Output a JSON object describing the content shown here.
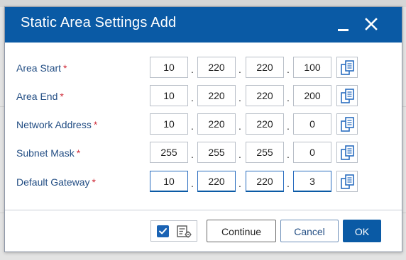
{
  "dialog": {
    "title": "Static Area Settings Add"
  },
  "title_bar": {
    "minimize_icon": "minimize-icon",
    "close_icon": "close-icon"
  },
  "required_marker": "*",
  "ip_separator": ".",
  "rows": [
    {
      "label": "Area Start",
      "octets": [
        "10",
        "220",
        "220",
        "100"
      ]
    },
    {
      "label": "Area End",
      "octets": [
        "10",
        "220",
        "220",
        "200"
      ]
    },
    {
      "label": "Network Address",
      "octets": [
        "10",
        "220",
        "220",
        "0"
      ]
    },
    {
      "label": "Subnet Mask",
      "octets": [
        "255",
        "255",
        "255",
        "0"
      ]
    },
    {
      "label": "Default Gateway",
      "octets": [
        "10",
        "220",
        "220",
        "3"
      ]
    }
  ],
  "row_copy_icon": "copy-icon",
  "footer": {
    "checkbox_checked": true,
    "settings_icon": "list-settings-icon",
    "continue_label": "Continue",
    "cancel_label": "Cancel",
    "ok_label": "OK"
  },
  "colors": {
    "title_bar": "#0a5aa5",
    "label_text": "#234e84",
    "required": "#d0303d",
    "primary_button": "#0a5aa5"
  }
}
